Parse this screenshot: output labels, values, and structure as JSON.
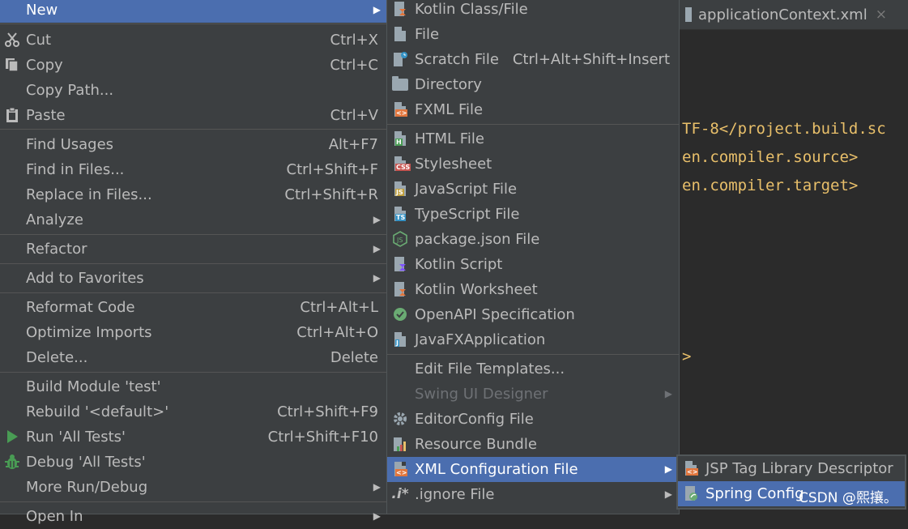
{
  "editor": {
    "tab_title": "applicationContext.xml",
    "tab_close": "×",
    "code_lines": [
      "TF-8</project.build.sc",
      "en.compiler.source>",
      "en.compiler.target>",
      ">"
    ]
  },
  "main_menu": {
    "items": [
      {
        "label": "New",
        "arrow": "▶"
      },
      {
        "label": "Cut",
        "shortcut": "Ctrl+X"
      },
      {
        "label": "Copy",
        "shortcut": "Ctrl+C"
      },
      {
        "label": "Copy Path...",
        "shortcut": ""
      },
      {
        "label": "Paste",
        "shortcut": "Ctrl+V"
      },
      {
        "label": "Find Usages",
        "shortcut": "Alt+F7"
      },
      {
        "label": "Find in Files...",
        "shortcut": "Ctrl+Shift+F"
      },
      {
        "label": "Replace in Files...",
        "shortcut": "Ctrl+Shift+R"
      },
      {
        "label": "Analyze",
        "arrow": "▶"
      },
      {
        "label": "Refactor",
        "arrow": "▶"
      },
      {
        "label": "Add to Favorites",
        "arrow": "▶"
      },
      {
        "label": "Reformat Code",
        "shortcut": "Ctrl+Alt+L"
      },
      {
        "label": "Optimize Imports",
        "shortcut": "Ctrl+Alt+O"
      },
      {
        "label": "Delete...",
        "shortcut": "Delete"
      },
      {
        "label": "Build Module 'test'"
      },
      {
        "label": "Rebuild '<default>'",
        "shortcut": "Ctrl+Shift+F9"
      },
      {
        "label": "Run 'All Tests'",
        "shortcut": "Ctrl+Shift+F10"
      },
      {
        "label": "Debug 'All Tests'"
      },
      {
        "label": "More Run/Debug",
        "arrow": "▶"
      },
      {
        "label": "Open In",
        "arrow": "▶"
      }
    ]
  },
  "new_menu": {
    "items": [
      {
        "label": "Kotlin Class/File"
      },
      {
        "label": "File"
      },
      {
        "label": "Scratch File",
        "shortcut": "Ctrl+Alt+Shift+Insert"
      },
      {
        "label": "Directory"
      },
      {
        "label": "FXML File"
      },
      {
        "label": "HTML File"
      },
      {
        "label": "Stylesheet"
      },
      {
        "label": "JavaScript File"
      },
      {
        "label": "TypeScript File"
      },
      {
        "label": "package.json File"
      },
      {
        "label": "Kotlin Script"
      },
      {
        "label": "Kotlin Worksheet"
      },
      {
        "label": "OpenAPI Specification"
      },
      {
        "label": "JavaFXApplication"
      },
      {
        "label": "Edit File Templates..."
      },
      {
        "label": "Swing UI Designer",
        "arrow": "▶"
      },
      {
        "label": "EditorConfig File"
      },
      {
        "label": "Resource Bundle"
      },
      {
        "label": "XML Configuration File",
        "arrow": "▶"
      },
      {
        "label": ".ignore File",
        "arrow": "▶"
      }
    ]
  },
  "xml_menu": {
    "items": [
      {
        "label": "JSP Tag Library Descriptor"
      },
      {
        "label": "Spring Config"
      }
    ]
  },
  "watermark": "CSDN @熙攘。",
  "colors": {
    "menu_bg": "#3c3f41",
    "highlight": "#4b6eaf",
    "editor_bg": "#2b2b2b",
    "xml_tag": "#e8bf6a"
  }
}
